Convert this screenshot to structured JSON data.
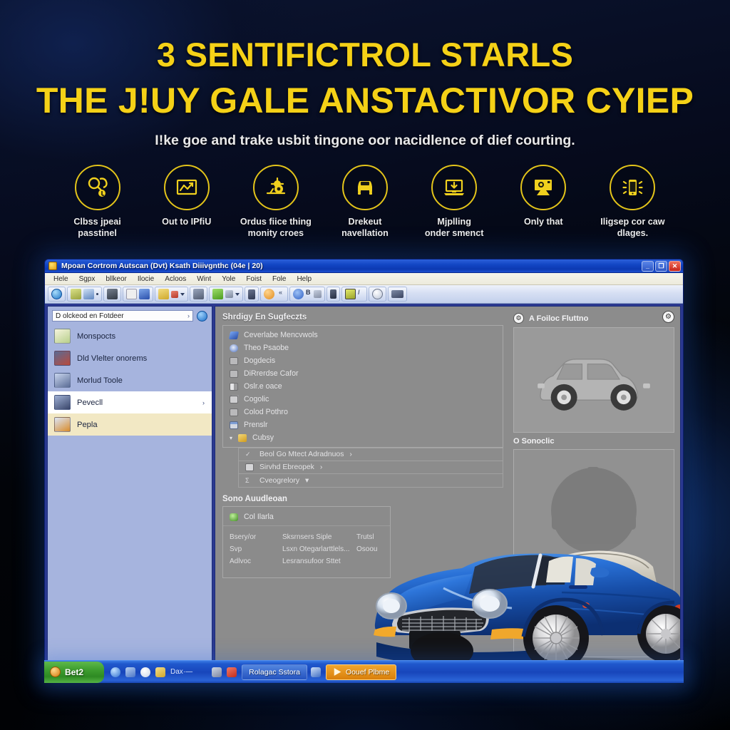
{
  "hero": {
    "title_line1": "3 SENTIFICTROL STARLS",
    "title_line2": "THE J!UY GALE ANSTACTIVOR CYIEP",
    "subtitle": "I!ke goe and trake usbit tingone oor nacidlence of dief courting.",
    "title_color": "#f5d117",
    "subtitle_color": "#e9e9ea"
  },
  "features": [
    {
      "icon": "magnifier-key-icon",
      "label": "Clbss jpeai\npasstinel"
    },
    {
      "icon": "chart-screen-icon",
      "label": "Out to IPfiU"
    },
    {
      "icon": "gear-scale-icon",
      "label": "Ordus fiice thing\nmonity croes"
    },
    {
      "icon": "car-front-icon",
      "label": "Drekeut\nnavellation"
    },
    {
      "icon": "laptop-download-icon",
      "label": "Mjplling\nonder smenct"
    },
    {
      "icon": "monitor-diag-icon",
      "label": "Only that"
    },
    {
      "icon": "phone-vibrate-icon",
      "label": "Iligsep cor caw dlages."
    }
  ],
  "window": {
    "title": "Mpoan Cortrom Autscan (Dvt) Ksath Diiivgnthc (04e | 20)",
    "app_icon": "app-orb-icon",
    "controls": {
      "minimize": "_",
      "maximize": "❐",
      "close": "✕"
    },
    "menu": [
      "Hele",
      "Sgpx",
      "bllkeor",
      "Ilocie",
      "Acloos",
      "Wint",
      "Yole",
      "Foist",
      "Fole",
      "Help"
    ]
  },
  "toolbar": {
    "groups": [
      {
        "items": [
          {
            "icon": "globe-icon",
            "color": "#3f9fe0"
          }
        ]
      },
      {
        "items": [
          {
            "icon": "folder-open-icon",
            "color": "#c8cf72"
          },
          {
            "icon": "disc-icon",
            "color": "#7ea5d8"
          },
          {
            "icon": "dot-icon",
            "color": "#2d3d60"
          }
        ]
      },
      {
        "items": [
          {
            "icon": "grid-view-icon",
            "color": "#4a4f58"
          }
        ]
      },
      {
        "items": [
          {
            "icon": "text-tool-icon",
            "color": "#e8e8ea"
          },
          {
            "icon": "anchor-icon",
            "color": "#3f6fd0"
          }
        ]
      },
      {
        "items": [
          {
            "icon": "folder-icon",
            "color": "#e2c557"
          },
          {
            "icon": "tag-icon",
            "color": "#d04b3b"
          },
          {
            "icon": "caret-icon",
            "color": "#2d3d60"
          }
        ]
      },
      {
        "items": [
          {
            "icon": "print-icon",
            "color": "#6f7d96"
          }
        ]
      },
      {
        "items": [
          {
            "icon": "forward-arrow-icon",
            "color": "#6fbd3a"
          },
          {
            "icon": "link-icon",
            "color": "#9aa7bd"
          },
          {
            "icon": "caret-icon",
            "color": "#2d3d60"
          }
        ]
      },
      {
        "items": [
          {
            "icon": "mobile-icon",
            "color": "#45506b"
          }
        ]
      },
      {
        "items": [
          {
            "icon": "sun-orb-icon",
            "color": "#f0a43a"
          },
          {
            "icon": "code-icon",
            "color": "#2d3d60"
          }
        ]
      },
      {
        "items": [
          {
            "icon": "settings-gear-icon",
            "color": "#4d7fd6"
          },
          {
            "icon": "bold-b-icon",
            "color": "#33405c"
          },
          {
            "icon": "upload-icon",
            "color": "#9aa7bd"
          }
        ]
      },
      {
        "items": [
          {
            "icon": "book-icon",
            "color": "#3c4660"
          }
        ]
      },
      {
        "items": [
          {
            "icon": "image-icon",
            "color": "#c9d23f"
          },
          {
            "icon": "italic-icon",
            "color": "#33405c"
          }
        ]
      },
      {
        "items": [
          {
            "icon": "palette-icon",
            "color": "#dfe4ef"
          }
        ]
      },
      {
        "items": [
          {
            "icon": "card-icon",
            "color": "#4b5772"
          }
        ]
      }
    ]
  },
  "sidebar": {
    "address_value": "D olckeod en Fotdeer",
    "address_chevron": "›",
    "go_icon": "refresh-go-icon",
    "items": [
      {
        "label": "Monspocts",
        "icon": "document-icon",
        "state": "normal",
        "arrow": ""
      },
      {
        "label": "Dld Vlelter onorems",
        "icon": "user-icon",
        "state": "normal",
        "arrow": ""
      },
      {
        "label": "Morlud Toole",
        "icon": "tools-icon",
        "state": "normal",
        "arrow": ""
      },
      {
        "label": "Pevecll",
        "icon": "lock-icon",
        "state": "selected-white",
        "arrow": "›"
      },
      {
        "label": "Pepla",
        "icon": "star-icon",
        "state": "selected-cream",
        "arrow": ""
      }
    ]
  },
  "main": {
    "list_title": "Shrdigy En Sugfeczts",
    "rows": [
      {
        "label": "Ceverlabe Mencvwols",
        "icon": "blue-flag-icon",
        "arrow": ""
      },
      {
        "label": "Theo Psaobe",
        "icon": "radio-icon",
        "arrow": ""
      },
      {
        "label": "Dogdecis",
        "icon": "box-icon",
        "arrow": ""
      },
      {
        "label": "DiRrerdse Cafor",
        "icon": "box-icon",
        "arrow": ""
      },
      {
        "label": "Oslr.e oace",
        "icon": "half-box-icon",
        "arrow": ""
      },
      {
        "label": "Cogolic",
        "icon": "copy-icon",
        "arrow": ""
      },
      {
        "label": "Colod Pothro",
        "icon": "box-icon",
        "arrow": ""
      },
      {
        "label": "Prenslr",
        "icon": "window-icon",
        "arrow": ""
      },
      {
        "label": "Cubsy",
        "icon": "folder-open-icon",
        "arrow": "▾"
      }
    ],
    "sub_rows": [
      {
        "label": "Beol Go Mtect Adradnuos",
        "icon": "check-icon",
        "arrow": "›"
      },
      {
        "label": "Sirvhd Ebreopek",
        "icon": "box-icon",
        "arrow": "›"
      },
      {
        "label": "Cveogrelory",
        "icon": "sigma-icon",
        "arrow": "▾"
      }
    ],
    "info_title": "Sono Auudleoan",
    "info_head": {
      "label": "Col Ilarla",
      "icon": "green-gem-icon"
    },
    "info_lines": [
      {
        "k": "Bsery/or",
        "v": "Sksrnsers Siple",
        "x": "Trutsl"
      },
      {
        "k": "Svp",
        "v": "Lsxn Otegarlarttlels...",
        "x": "Osoou"
      },
      {
        "k": "Adlvoc",
        "v": "Lesransufoor Sttet",
        "x": ""
      }
    ]
  },
  "preview": {
    "top_badge": "car-badge-icon",
    "corner_badge": "car-badge-icon",
    "top_label": "A Foiloc Fluttno",
    "bottom_label": "O Sonoclic",
    "top_image": "car-side-gray-illustration",
    "bottom_image": "engine-gray-illustration",
    "hero_image": "blue-convertible-car-photo"
  },
  "taskbar": {
    "start_label": "Bet2",
    "quick_launch": [
      {
        "icon": "ie-browser-icon",
        "color": "#5f9bea"
      },
      {
        "icon": "media-icon",
        "color": "#7ba4e0"
      },
      {
        "icon": "opera-o-icon",
        "color": "#f4f4f4"
      },
      {
        "icon": "folder-icon",
        "color": "#e2c557"
      }
    ],
    "quick_label": "Dax·—",
    "tasks": [
      {
        "label": "Rolagac Sstora",
        "icon": "window-icon",
        "active": false
      },
      {
        "label": "Oouef Plbme",
        "icon": "play-icon",
        "active": true
      }
    ],
    "tray_icon": "network-icon"
  },
  "colors": {
    "accent_yellow": "#f5d117",
    "window_blue": "#2b3990",
    "titlebar_blue": "#1246c4",
    "sidebar_blue": "#a6b4de",
    "panel_gray": "#8c8c8c",
    "start_green": "#3e9e2f",
    "car_blue": "#1f5fc8"
  }
}
